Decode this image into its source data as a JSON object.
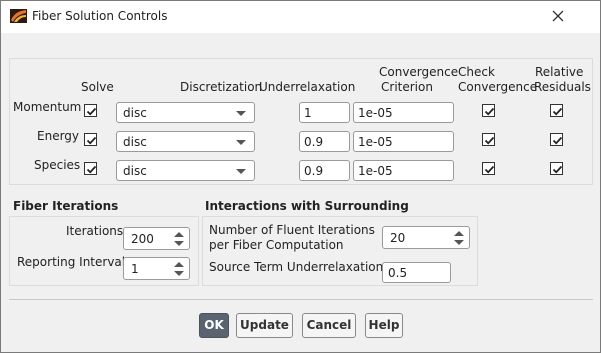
{
  "window": {
    "title": "Fiber Solution Controls"
  },
  "equations_table": {
    "headers": {
      "solve": "Solve",
      "discretization": "Discretization",
      "underrelaxation": "Underrelaxation",
      "convergence_criterion_line1": "Convergence",
      "convergence_criterion_line2": "Criterion",
      "check_convergence_line1": "Check",
      "check_convergence_line2": "Convergence",
      "relative_residuals_line1": "Relative",
      "relative_residuals_line2": "Residuals"
    },
    "rows": [
      {
        "label": "Momentum",
        "solve": true,
        "discretization": "disc",
        "underrelaxation": "1",
        "criterion": "1e-05",
        "check": true,
        "relative": true
      },
      {
        "label": "Energy",
        "solve": true,
        "discretization": "disc",
        "underrelaxation": "0.9",
        "criterion": "1e-05",
        "check": true,
        "relative": true
      },
      {
        "label": "Species",
        "solve": true,
        "discretization": "disc",
        "underrelaxation": "0.9",
        "criterion": "1e-05",
        "check": true,
        "relative": true
      }
    ]
  },
  "fiber_iterations": {
    "title": "Fiber Iterations",
    "iterations_label": "Iterations",
    "iterations_value": "200",
    "reporting_label": "Reporting Interval",
    "reporting_value": "1"
  },
  "interactions": {
    "title": "Interactions with Surrounding",
    "fluent_label_line1": "Number of Fluent Iterations",
    "fluent_label_line2": "per Fiber Computation",
    "fluent_value": "20",
    "source_label": "Source Term Underrelaxation",
    "source_value": "0.5"
  },
  "buttons": {
    "ok": "OK",
    "update": "Update",
    "cancel": "Cancel",
    "help": "Help"
  },
  "icons": {
    "app": "fluent-app-icon",
    "close": "close-icon"
  },
  "colors": {
    "primary_button": "#5a6470",
    "background": "#f0f0f0"
  }
}
